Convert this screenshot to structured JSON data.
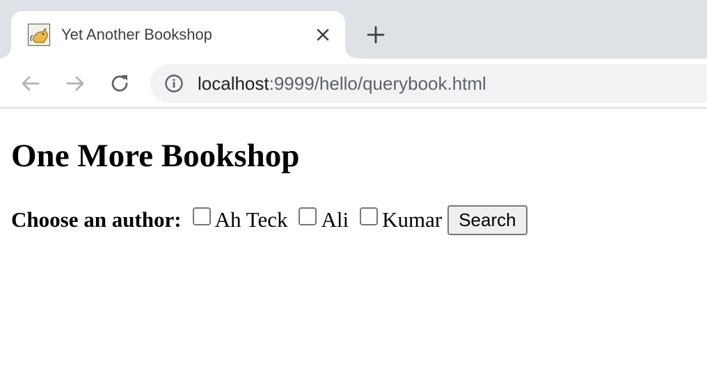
{
  "browser": {
    "tab": {
      "title": "Yet Another Bookshop",
      "favicon": "tomcat-icon"
    },
    "url": {
      "host": "localhost",
      "path": ":9999/hello/querybook.html"
    },
    "icons": {
      "back": "arrow-left-icon",
      "forward": "arrow-right-icon",
      "reload": "reload-icon",
      "info": "info-icon",
      "close": "close-icon",
      "new_tab": "plus-icon"
    }
  },
  "page": {
    "heading": "One More Bookshop",
    "form": {
      "label": "Choose an author:",
      "authors": [
        {
          "label": "Ah Teck",
          "checked": false
        },
        {
          "label": "Ali",
          "checked": false
        },
        {
          "label": "Kumar",
          "checked": false
        }
      ],
      "submit_label": "Search"
    }
  }
}
